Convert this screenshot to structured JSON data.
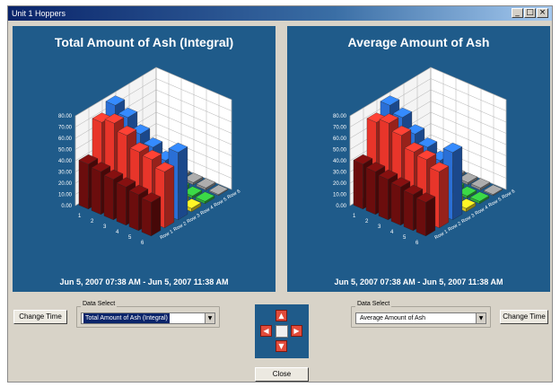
{
  "window": {
    "title": "Unit 1 Hoppers",
    "buttons": {
      "minimize": "_",
      "maximize": "□",
      "close": "×"
    }
  },
  "left_panel": {
    "title": "Total Amount of Ash (Integral)",
    "footer": "Jun 5, 2007 07:38 AM - Jun 5, 2007 11:38 AM",
    "change_time_label": "Change Time",
    "data_select_label": "Data Select",
    "data_select_value": "Total Amount of Ash (Integral)"
  },
  "right_panel": {
    "title": "Average Amount of Ash",
    "footer": "Jun 5, 2007 07:38 AM - Jun 5, 2007 11:38 AM",
    "change_time_label": "Change Time",
    "data_select_label": "Data Select",
    "data_select_value": "Average Amount of Ash"
  },
  "nav": {
    "up": "▲",
    "down": "▼",
    "left": "◀",
    "right": "▶"
  },
  "close_label": "Close",
  "chart_data": [
    {
      "type": "bar",
      "title": "Total Amount of Ash (Integral)",
      "y_ticks": [
        "0.00",
        "10.00",
        "20.00",
        "30.00",
        "40.00",
        "50.00",
        "60.00",
        "70.00",
        "80.00"
      ],
      "x_categories": [
        "1",
        "2",
        "3",
        "4",
        "5",
        "6"
      ],
      "depth_categories": [
        "Row 1",
        "Row 2",
        "Row 3",
        "Row 4",
        "Row 5",
        "Row 6"
      ],
      "ylim": [
        0,
        80
      ],
      "series": [
        {
          "name": "Row 1",
          "values": [
            40,
            38,
            36,
            34,
            32,
            30
          ]
        },
        {
          "name": "Row 2",
          "values": [
            70,
            74,
            68,
            58,
            56,
            50
          ]
        },
        {
          "name": "Row 3",
          "values": [
            78,
            72,
            62,
            55,
            48,
            60
          ]
        },
        {
          "name": "Row 4",
          "values": [
            8,
            7,
            6,
            5,
            4,
            3
          ]
        },
        {
          "name": "Row 5",
          "values": [
            5,
            4,
            3,
            3,
            2,
            2
          ]
        },
        {
          "name": "Row 6",
          "values": [
            3,
            3,
            2,
            2,
            2,
            1
          ]
        }
      ],
      "colors": [
        "#6b0d0d",
        "#e8352a",
        "#2a6fd6",
        "#d6c51e",
        "#2fae39",
        "#8a8a8a"
      ]
    },
    {
      "type": "bar",
      "title": "Average Amount of Ash",
      "y_ticks": [
        "0.00",
        "10.00",
        "20.00",
        "30.00",
        "40.00",
        "50.00",
        "60.00",
        "70.00",
        "80.00"
      ],
      "x_categories": [
        "1",
        "2",
        "3",
        "4",
        "5",
        "6"
      ],
      "depth_categories": [
        "Row 1",
        "Row 2",
        "Row 3",
        "Row 4",
        "Row 5",
        "Row 6"
      ],
      "ylim": [
        0,
        80
      ],
      "series": [
        {
          "name": "Row 1",
          "values": [
            40,
            38,
            36,
            34,
            32,
            30
          ]
        },
        {
          "name": "Row 2",
          "values": [
            70,
            74,
            68,
            58,
            56,
            50
          ]
        },
        {
          "name": "Row 3",
          "values": [
            78,
            72,
            62,
            55,
            48,
            60
          ]
        },
        {
          "name": "Row 4",
          "values": [
            8,
            7,
            6,
            5,
            4,
            3
          ]
        },
        {
          "name": "Row 5",
          "values": [
            5,
            4,
            3,
            3,
            2,
            2
          ]
        },
        {
          "name": "Row 6",
          "values": [
            3,
            3,
            2,
            2,
            2,
            1
          ]
        }
      ],
      "colors": [
        "#6b0d0d",
        "#e8352a",
        "#2a6fd6",
        "#d6c51e",
        "#2fae39",
        "#8a8a8a"
      ]
    }
  ]
}
